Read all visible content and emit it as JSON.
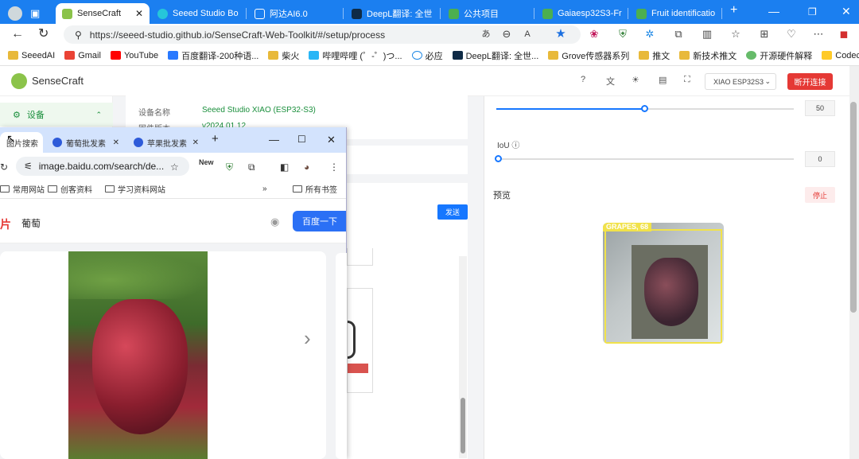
{
  "edge": {
    "tabs": [
      {
        "label": "SenseCraft",
        "active": true
      },
      {
        "label": "Seeed Studio Bo"
      },
      {
        "label": "阿达AI6.0"
      },
      {
        "label": "DeepL翻译: 全世"
      },
      {
        "label": "公共项目"
      },
      {
        "label": "Gaiaesp32S3-Fr"
      },
      {
        "label": "Fruit identificatio"
      }
    ],
    "url": "https://seeed-studio.github.io/SenseCraft-Web-Toolkit/#/setup/process",
    "bookmarks": [
      "SeeedAI",
      "Gmail",
      "YouTube",
      "百度翻译-200种语...",
      "柴火",
      "哔哩哔哩 (゜-゜)つ...",
      "必应",
      "DeepL翻译: 全世...",
      "Grove传感器系列",
      "推文",
      "新技术推文",
      "开源硬件解释",
      "Codecraft"
    ]
  },
  "sensecraft": {
    "brand": "SenseCraft",
    "device": "XIAO ESP32S3",
    "disconnect": "断开连接",
    "sidebar": {
      "settings": "设备"
    },
    "info": [
      {
        "key": "设备名称",
        "value": "Seeed Studio XIAO (ESP32-S3)"
      },
      {
        "key": "固件版本",
        "value": "v2024.01.12"
      }
    ],
    "send": "发送",
    "confidence_value": "50",
    "confidence_fill": 0.5,
    "iou_label": "IoU",
    "iou_value": "0",
    "preview_label": "预览",
    "stop": "停止",
    "detection_label": "GRAPES, 68"
  },
  "chrome": {
    "tabs": [
      {
        "label": "图片搜索"
      },
      {
        "label": "葡萄批发素"
      },
      {
        "label": "苹果批发素"
      }
    ],
    "url": "image.baidu.com/search/de...",
    "bookmarks": [
      "常用网站",
      "创客资料",
      "学习资料网站",
      "所有书签"
    ],
    "bookmarks_more": "»",
    "query": "葡萄",
    "search_btn": "百度一下",
    "new_badge": "New"
  }
}
